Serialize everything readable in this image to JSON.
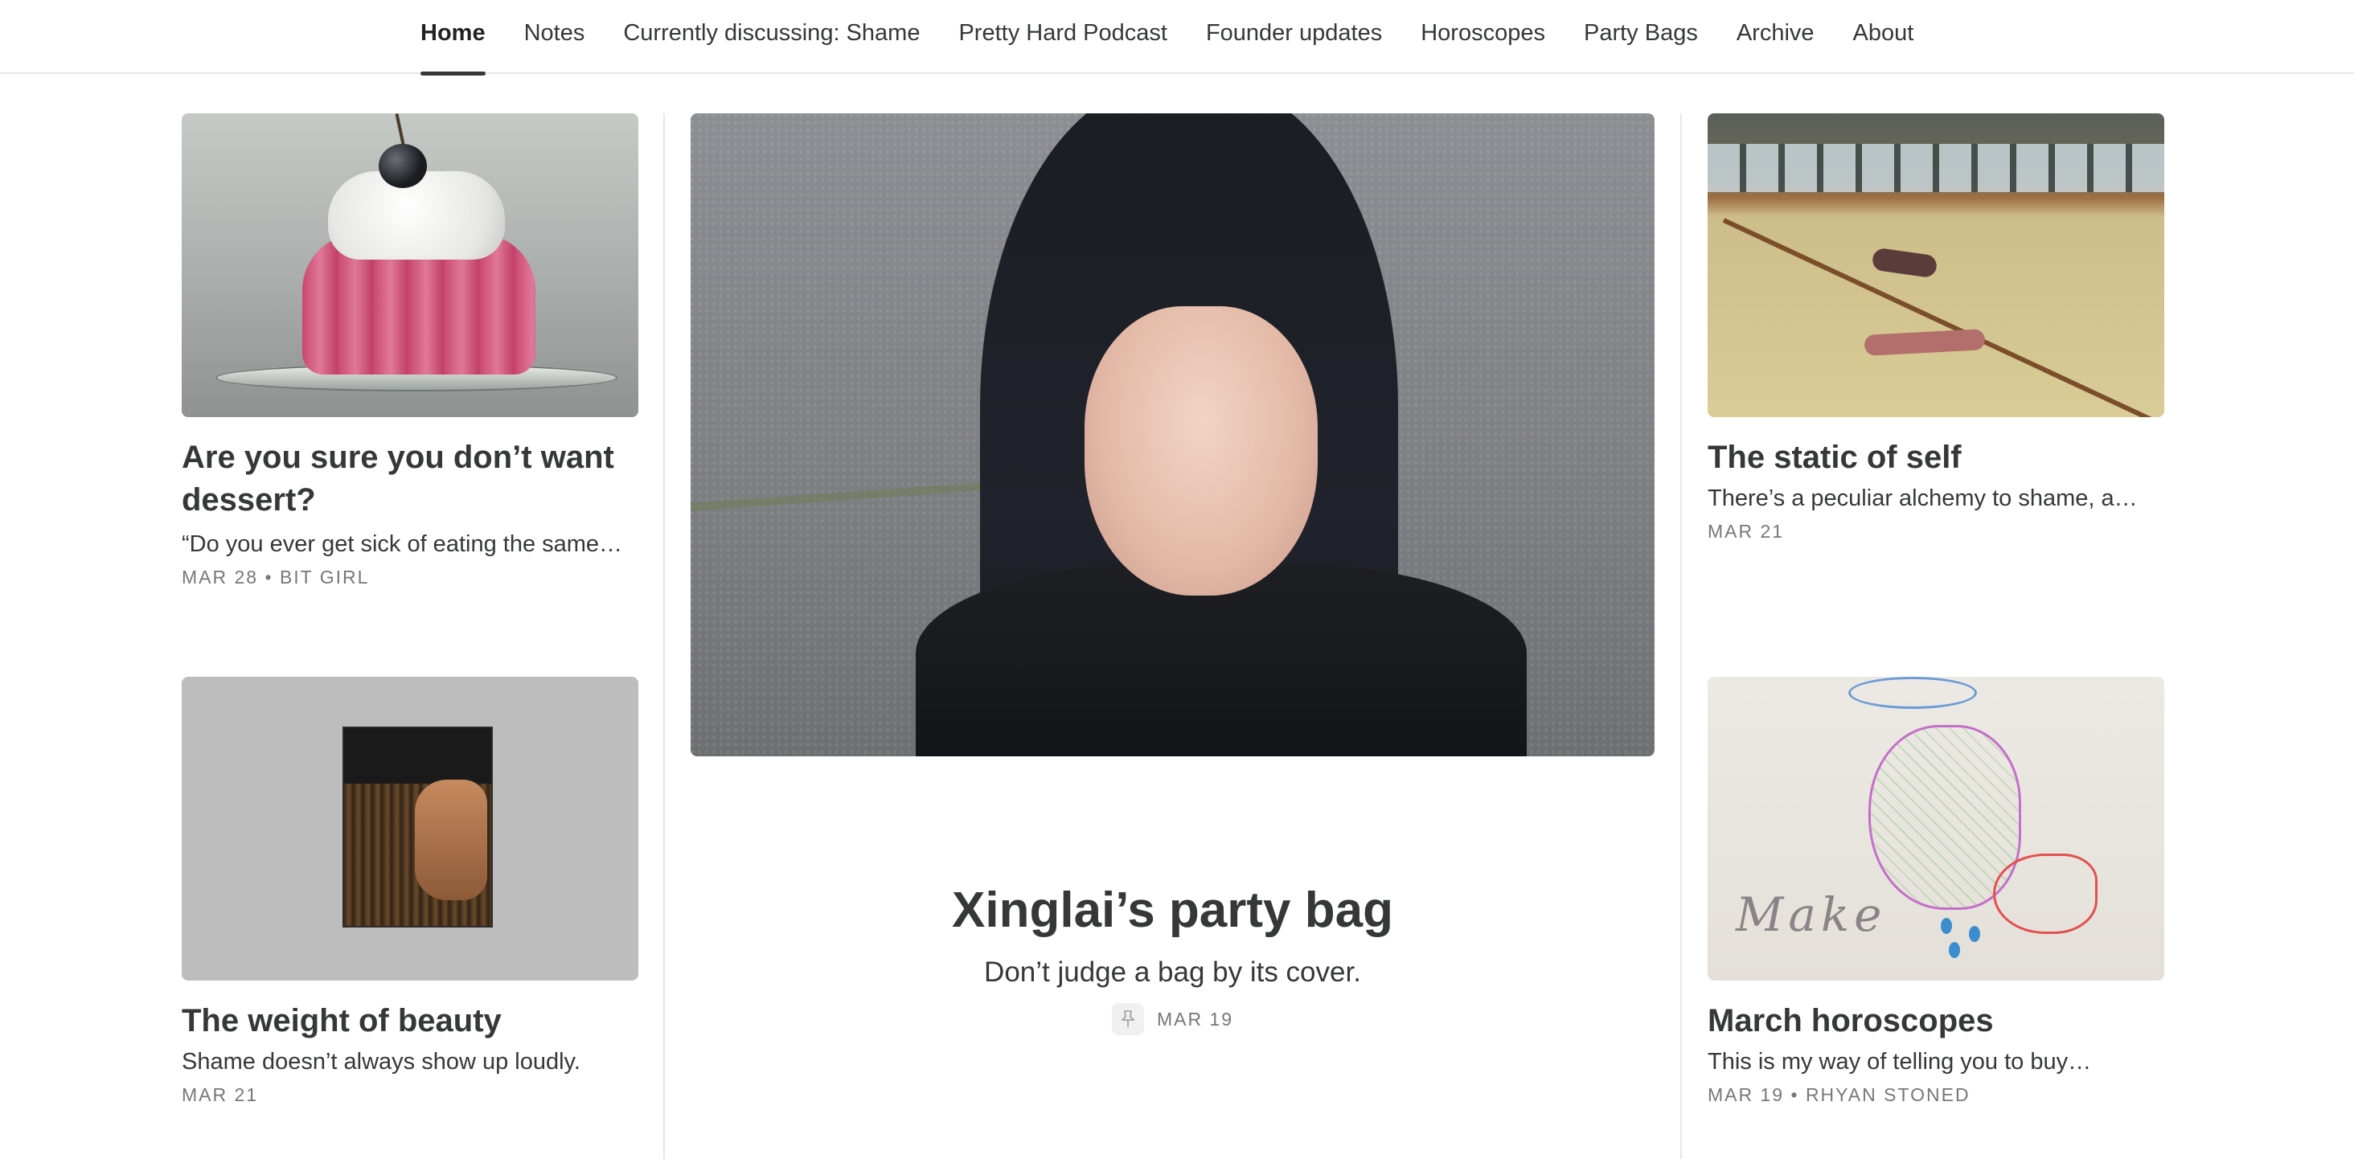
{
  "nav": {
    "items": [
      {
        "label": "Home",
        "active": true
      },
      {
        "label": "Notes"
      },
      {
        "label": "Currently discussing: Shame"
      },
      {
        "label": "Pretty Hard Podcast"
      },
      {
        "label": "Founder updates"
      },
      {
        "label": "Horoscopes"
      },
      {
        "label": "Party Bags"
      },
      {
        "label": "Archive"
      },
      {
        "label": "About"
      }
    ]
  },
  "posts": {
    "dessert": {
      "title": "Are you sure you don’t want dessert?",
      "subtitle": "“Do you ever get sick of eating the same…",
      "date": "MAR 28",
      "author": "BIT GIRL",
      "thumb_icon": "jelly-dessert-photo"
    },
    "static_self": {
      "title": "The static of self",
      "subtitle": "There’s a peculiar alchemy to shame, a…",
      "date": "MAR 21",
      "thumb_icon": "gym-floor-photo"
    },
    "weight_beauty": {
      "title": "The weight of beauty",
      "subtitle": "Shame doesn’t always show up loudly.",
      "date": "MAR 21",
      "thumb_icon": "portrait-photo"
    },
    "horoscopes": {
      "title": "March horoscopes",
      "subtitle": "This is my way of telling you to buy…",
      "date": "MAR 19",
      "author": "RHYAN STONED",
      "thumb_word": "Make",
      "thumb_icon": "drawing-image"
    }
  },
  "featured": {
    "title": "Xinglai’s party bag",
    "subtitle": "Don’t judge a bag by its cover.",
    "date": "MAR 19",
    "pin_icon": "pin-icon",
    "image_icon": "portrait-photo"
  },
  "meta_separator": "•",
  "colors": {
    "text": "#363737",
    "muted": "#777777",
    "divider": "#e6e6e6",
    "background": "#ffffff"
  }
}
